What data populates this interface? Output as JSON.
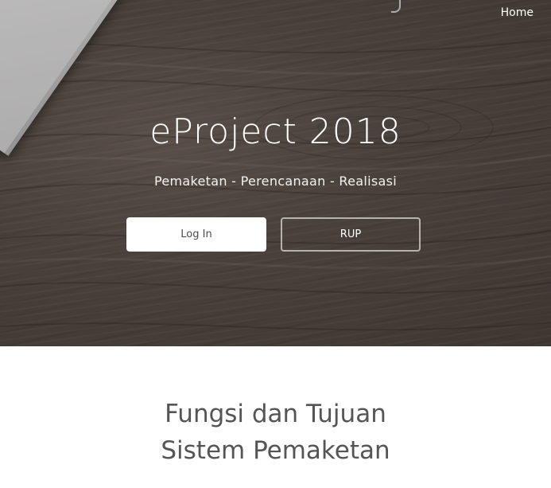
{
  "nav": {
    "home_label": "Home"
  },
  "hero": {
    "title": "eProject 2018",
    "subtitle": "Pemaketan - Perencanaan - Realisasi",
    "login_button": "Log In",
    "rup_button": "RUP"
  },
  "section": {
    "heading_line1": "Fungsi dan Tujuan",
    "heading_line2": "Sistem Pemaketan"
  },
  "colors": {
    "hero_background": "#5a5049",
    "button_primary_bg": "#ffffff",
    "heading_text": "#555555"
  }
}
